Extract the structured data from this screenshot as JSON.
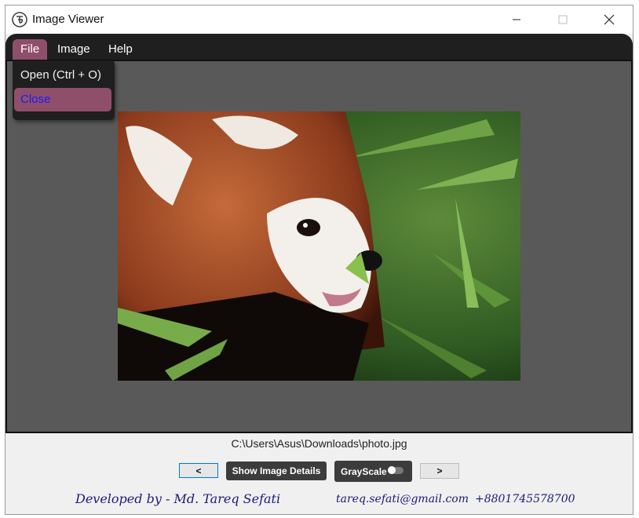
{
  "window": {
    "title": "Image Viewer"
  },
  "menu": {
    "items": [
      {
        "label": "File"
      },
      {
        "label": "Image"
      },
      {
        "label": "Help"
      }
    ]
  },
  "file_menu": {
    "items": [
      {
        "label": "Open (Ctrl + O)"
      },
      {
        "label": "Close"
      }
    ]
  },
  "image": {
    "path": "C:\\Users\\Asus\\Downloads\\photo.jpg"
  },
  "controls": {
    "prev_label": "<",
    "details_label": "Show Image Details",
    "grayscale_label": "GrayScale",
    "next_label": ">"
  },
  "footer": {
    "developer": "Developed by - Md. Tareq Sefati",
    "email": "tareq.sefati@gmail.com",
    "phone": "+8801745578700"
  },
  "colors": {
    "menu_active": "#8f4f6a",
    "menu_bg": "#1f1f1f",
    "viewer_bg": "#595959"
  }
}
